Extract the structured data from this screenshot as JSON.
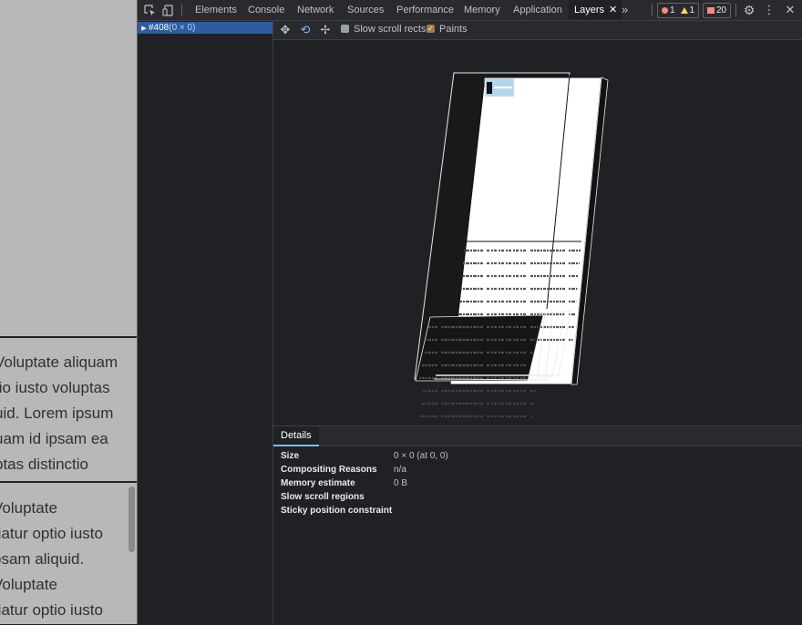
{
  "page": {
    "block1": [
      "Voluptate aliquam",
      "tio iusto voluptas",
      "uid. Lorem ipsum",
      "uam id ipsam ea",
      "ptas distinctio"
    ],
    "block2": [
      "Voluptate",
      "riatur optio iusto",
      "psam aliquid.",
      "Voluptate",
      "riatur optio iusto"
    ]
  },
  "devtools": {
    "tabs": [
      "Elements",
      "Console",
      "Network",
      "Sources",
      "Performance",
      "Memory",
      "Application",
      "Layers"
    ],
    "active_tab": "Layers",
    "more_tabs": "»",
    "badges": {
      "errors": "1",
      "warnings": "1",
      "issues": "20"
    }
  },
  "layer_tree": {
    "node_id": "#408",
    "node_size": "(0 × 0)"
  },
  "layers_toolbar": {
    "slow_scroll_rects": "Slow scroll rects",
    "paints": "Paints",
    "paints_checked": true,
    "slow_scroll_checked": false
  },
  "details": {
    "tab": "Details",
    "rows": [
      {
        "key": "Size",
        "value": "0 × 0 (at 0, 0)"
      },
      {
        "key": "Compositing Reasons",
        "value": "n/a"
      },
      {
        "key": "Memory estimate",
        "value": "0 B"
      },
      {
        "key": "Slow scroll regions",
        "value": ""
      },
      {
        "key": "Sticky position constraint",
        "value": ""
      }
    ]
  },
  "colors": {
    "selection": "#2d5d9f",
    "accent": "#8ab4f8",
    "panel": "#202124"
  }
}
